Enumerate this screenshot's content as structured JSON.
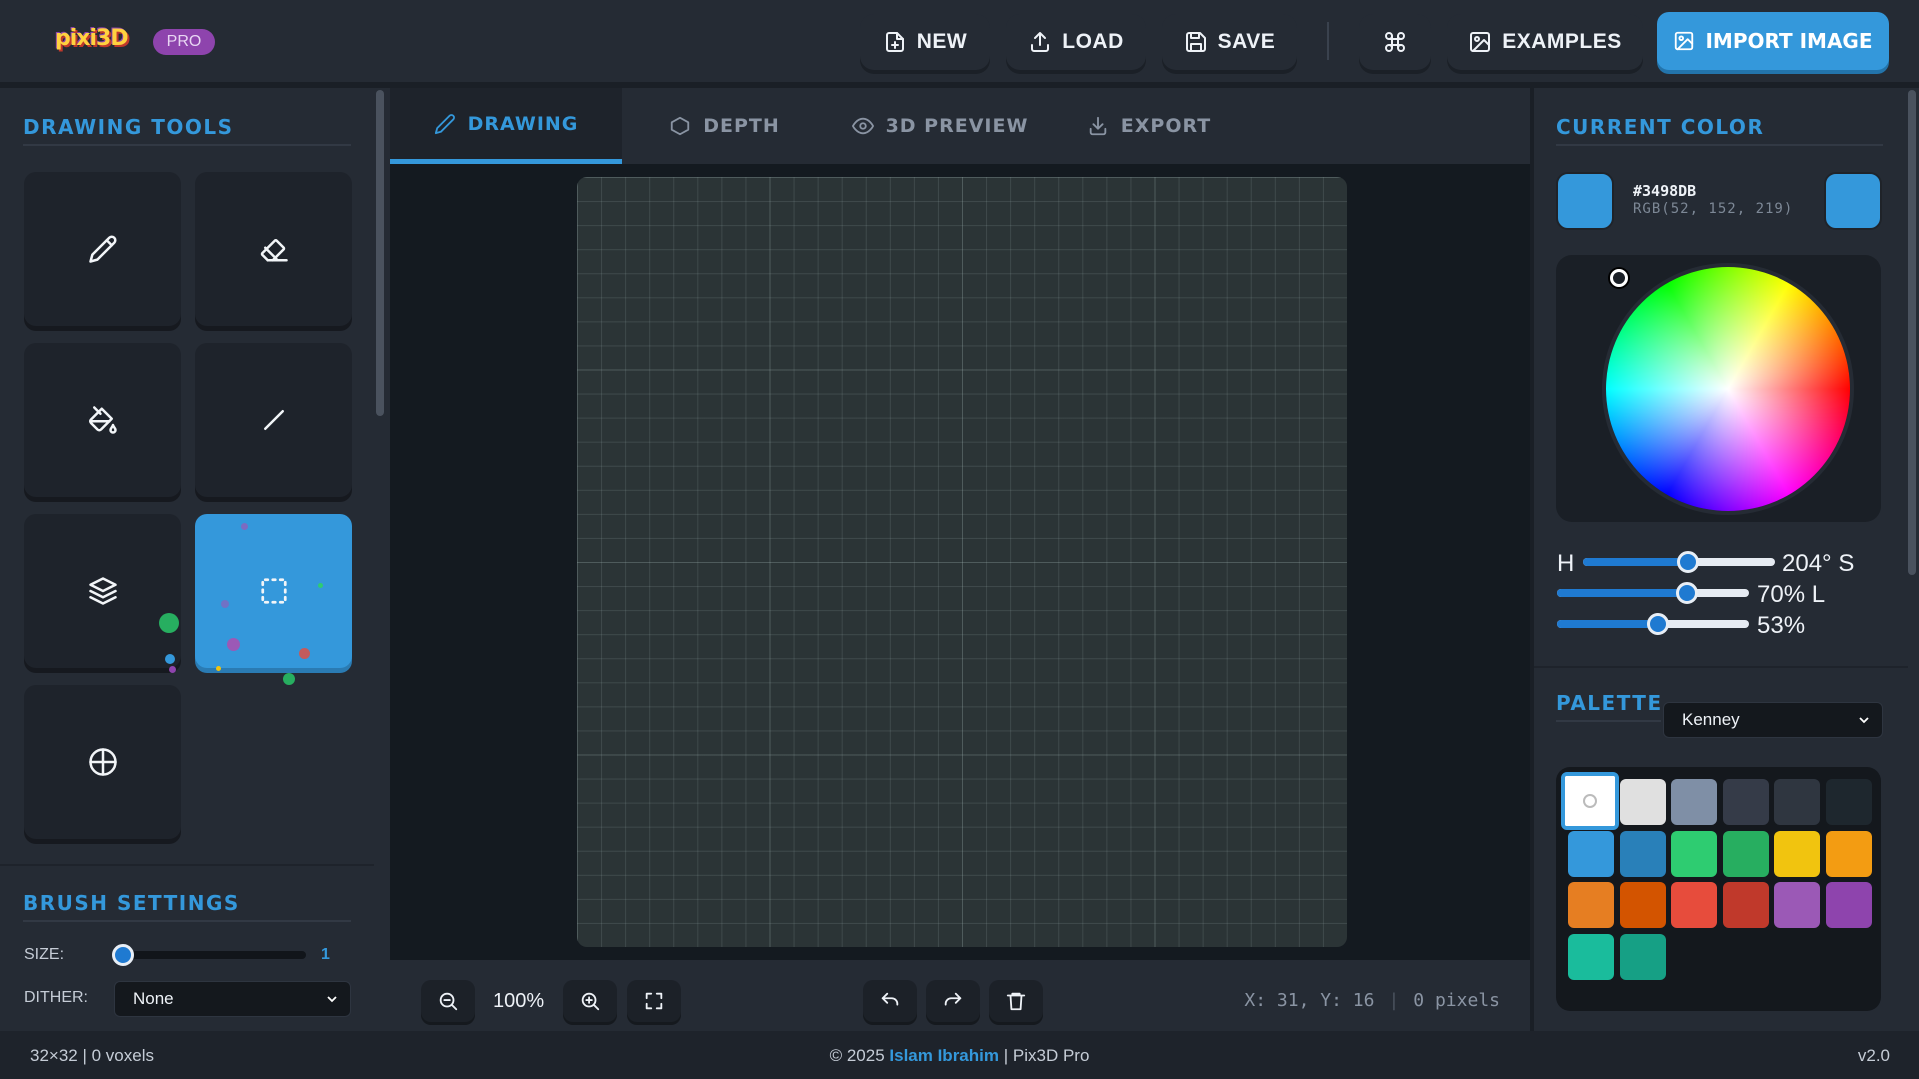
{
  "header": {
    "logo_text": "pixi3D",
    "badge": "PRO",
    "buttons": {
      "new": "NEW",
      "load": "LOAD",
      "save": "SAVE",
      "examples": "EXAMPLES",
      "import": "IMPORT IMAGE"
    }
  },
  "left_panel": {
    "tools_title": "DRAWING TOOLS",
    "tools": [
      {
        "name": "pencil-icon",
        "active": false
      },
      {
        "name": "eraser-icon",
        "active": false
      },
      {
        "name": "paint-bucket-icon",
        "active": false
      },
      {
        "name": "line-icon",
        "active": false
      },
      {
        "name": "layers-icon",
        "active": false
      },
      {
        "name": "select-icon",
        "active": true
      },
      {
        "name": "crosshair-icon",
        "active": false
      }
    ],
    "brush_title": "BRUSH SETTINGS",
    "size_label": "SIZE:",
    "size_value": "1",
    "dither_label": "DITHER:",
    "dither_value": "None"
  },
  "tabs": [
    {
      "label": "DRAWING",
      "icon": "pencil-icon",
      "active": true
    },
    {
      "label": "DEPTH",
      "icon": "hexagon-icon",
      "active": false
    },
    {
      "label": "3D PREVIEW",
      "icon": "eye-icon",
      "active": false
    },
    {
      "label": "EXPORT",
      "icon": "download-icon",
      "active": false
    }
  ],
  "canvas_bar": {
    "zoom": "100%",
    "coords": "X: 31, Y: 16",
    "pixels": "0 pixels"
  },
  "right_panel": {
    "color_title": "CURRENT COLOR",
    "hex": "#3498DB",
    "rgb": "RGB(52, 152, 219)",
    "current_color": "#3498DB",
    "hsl": {
      "h_label": "H",
      "h_value": "204°",
      "s_label": "S",
      "s_value": "70%",
      "l_label": "L",
      "l_value": "53%"
    },
    "palette_title": "PALETTE",
    "palette_name": "Kenney",
    "palette_colors": [
      "#FFFFFF",
      "#E0E0E0",
      "#7F8FA6",
      "#353B48",
      "#2F3640",
      "#1E272E",
      "#3498DB",
      "#2980B9",
      "#2ECC71",
      "#27AE60",
      "#F1C40F",
      "#F39C12",
      "#E67E22",
      "#D35400",
      "#E74C3C",
      "#C0392B",
      "#9B59B6",
      "#8E44AD",
      "#1ABC9C",
      "#16A085"
    ]
  },
  "footer": {
    "left": "32×32 | 0 voxels",
    "copyright": "© 2025",
    "author": "Islam Ibrahim",
    "product": "| Pix3D Pro",
    "version": "v2.0"
  }
}
